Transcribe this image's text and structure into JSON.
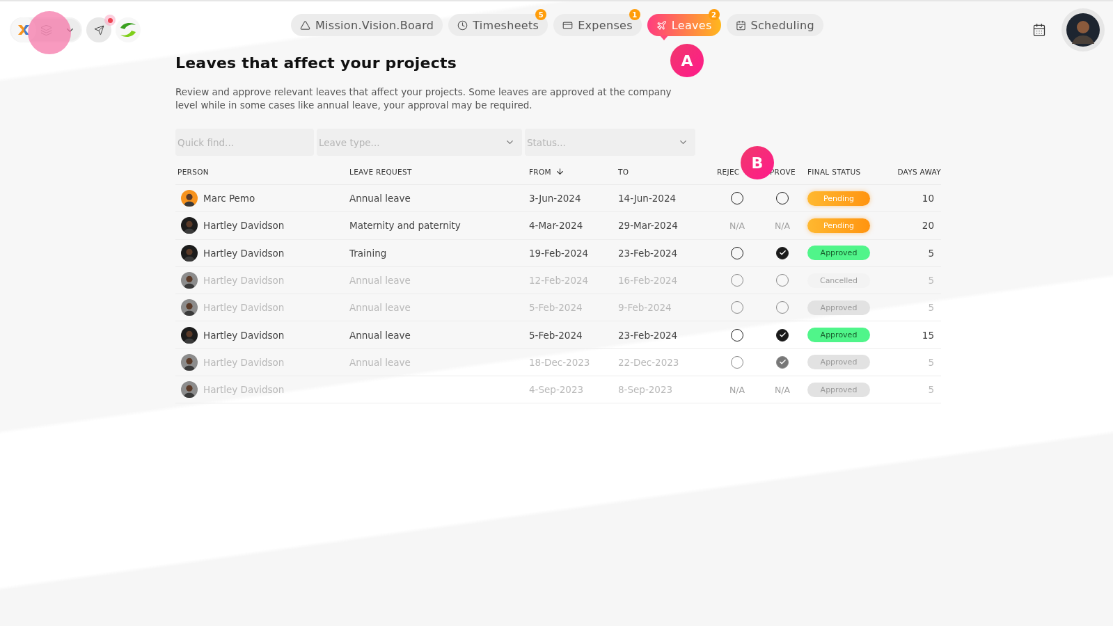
{
  "nav": [
    {
      "label": "Mission.Vision.Board",
      "selected": false
    },
    {
      "label": "Timesheets",
      "badge": "5",
      "selected": false
    },
    {
      "label": "Expenses",
      "badge": "1",
      "selected": false
    },
    {
      "label": "Leaves",
      "badge": "2",
      "selected": true
    },
    {
      "label": "Scheduling",
      "selected": false
    }
  ],
  "markers": [
    {
      "kind": "nav",
      "label": "A"
    },
    {
      "kind": "table",
      "label": "B"
    }
  ],
  "title": "Leaves that affect your projects",
  "description": "Review and approve relevant leaves that affect your projects. Some leaves are approved at the company level while in some cases like annual leave, your approval may be required.",
  "filters": {
    "search_placeholder": "Quick find...",
    "leave_type_placeholder": "Leave type...",
    "status_placeholder": "Status..."
  },
  "table": {
    "columns": [
      {
        "label": "PERSON"
      },
      {
        "label": "LEAVE REQUEST"
      },
      {
        "label": "FROM",
        "sorted": true
      },
      {
        "label": "TO"
      },
      {
        "label": "REJEC"
      },
      {
        "label": "PROVE"
      },
      {
        "label": "FINAL STATUS"
      },
      {
        "label": "DAYS AWAY"
      }
    ],
    "rows": [
      {
        "person": "Marc Pemo",
        "color": "#f7931e",
        "dimmed": false,
        "leave_request": "Annual leave",
        "from": "3-Jun-2024",
        "to": "14-Jun-2024",
        "reject": {
          "kind": "radio",
          "checked": false
        },
        "approve": {
          "kind": "radio",
          "checked": false
        },
        "status": {
          "kind": "pending",
          "label": "Pending"
        },
        "days_away": "10"
      },
      {
        "person": "Hartley Davidson",
        "color": "#1c1c1c",
        "dimmed": false,
        "leave_request": "Maternity and paternity",
        "from": "4-Mar-2024",
        "to": "29-Mar-2024",
        "reject": {
          "kind": "na",
          "text": "N/A"
        },
        "approve": {
          "kind": "na",
          "text": "N/A"
        },
        "status": {
          "kind": "pending",
          "label": "Pending"
        },
        "days_away": "20"
      },
      {
        "person": "Hartley Davidson",
        "color": "#1c1c1c",
        "dimmed": false,
        "leave_request": "Training",
        "from": "19-Feb-2024",
        "to": "23-Feb-2024",
        "reject": {
          "kind": "radio",
          "checked": false
        },
        "approve": {
          "kind": "radio",
          "checked": true
        },
        "status": {
          "kind": "approved",
          "label": "Approved"
        },
        "days_away": "5"
      },
      {
        "person": "Hartley Davidson",
        "color": "#8c8c8c",
        "dimmed": true,
        "leave_request": "Annual leave",
        "from": "12-Feb-2024",
        "to": "16-Feb-2024",
        "reject": {
          "kind": "radio",
          "checked": false
        },
        "approve": {
          "kind": "radio",
          "checked": false
        },
        "status": {
          "kind": "cancelled",
          "label": "Cancelled"
        },
        "days_away": "5"
      },
      {
        "person": "Hartley Davidson",
        "color": "#8c8c8c",
        "dimmed": true,
        "leave_request": "Annual leave",
        "from": "5-Feb-2024",
        "to": "9-Feb-2024",
        "reject": {
          "kind": "radio",
          "checked": false
        },
        "approve": {
          "kind": "radio",
          "checked": false
        },
        "status": {
          "kind": "approved",
          "label": "Approved"
        },
        "days_away": "5"
      },
      {
        "person": "Hartley Davidson",
        "color": "#1c1c1c",
        "dimmed": false,
        "leave_request": "Annual leave",
        "from": "5-Feb-2024",
        "to": "23-Feb-2024",
        "reject": {
          "kind": "radio",
          "checked": false
        },
        "approve": {
          "kind": "radio",
          "checked": true
        },
        "status": {
          "kind": "approved",
          "label": "Approved"
        },
        "days_away": "15"
      },
      {
        "person": "Hartley Davidson",
        "color": "#8c8c8c",
        "dimmed": true,
        "leave_request": "Annual leave",
        "from": "18-Dec-2023",
        "to": "22-Dec-2023",
        "reject": {
          "kind": "radio",
          "checked": false
        },
        "approve": {
          "kind": "radio",
          "checked": true
        },
        "status": {
          "kind": "approved",
          "label": "Approved"
        },
        "days_away": "5"
      },
      {
        "person": "Hartley Davidson",
        "color": "#8c8c8c",
        "dimmed": true,
        "from": "4-Sep-2023",
        "to": "8-Sep-2023",
        "reject": {
          "kind": "na",
          "text": "N/A"
        },
        "approve": {
          "kind": "na",
          "text": "N/A"
        },
        "status": {
          "kind": "approved",
          "label": "Approved"
        },
        "days_away": "5"
      }
    ]
  }
}
